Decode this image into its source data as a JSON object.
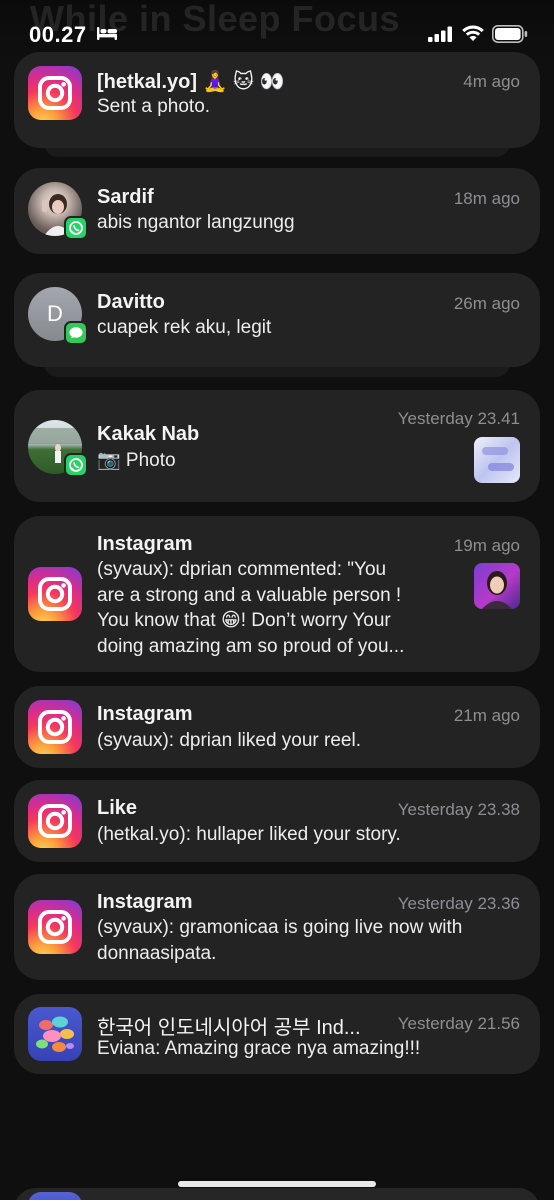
{
  "status_bar": {
    "ghost_title": "While in Sleep Focus",
    "time": "00.27",
    "icons": [
      "bed-icon",
      "signal-icon",
      "wifi-icon",
      "battery-icon"
    ]
  },
  "notifications": [
    {
      "app": "instagram",
      "title": "[hetkal.yo] 🧘‍♀️ 🐱 👀",
      "time": "4m ago",
      "body": [
        "Sent a photo."
      ]
    },
    {
      "app": "whatsapp",
      "title": "Sardif",
      "time": "18m ago",
      "body": [
        "abis ngantor langzungg"
      ]
    },
    {
      "app": "messages",
      "title": "Davitto",
      "time": "26m ago",
      "avatar_letter": "D",
      "body": [
        "cuapek rek aku, legit"
      ]
    },
    {
      "app": "whatsapp",
      "title": "Kakak Nab",
      "time": "Yesterday 23.41",
      "body": [
        "📷 Photo"
      ]
    },
    {
      "app": "instagram",
      "title": "Instagram",
      "time": "19m ago",
      "body": [
        "(syvaux): dprian commented: \"You",
        "are a strong and a valuable person !",
        "You know that 😁! Don’t worry Your",
        "doing amazing am so proud of you..."
      ]
    },
    {
      "app": "instagram",
      "title": "Instagram",
      "time": "21m ago",
      "body": [
        "(syvaux): dprian liked your reel."
      ]
    },
    {
      "app": "instagram",
      "title": "Like",
      "time": "Yesterday 23.38",
      "body": [
        "(hetkal.yo): hullaper liked your story."
      ]
    },
    {
      "app": "instagram",
      "title": "Instagram",
      "time": "Yesterday 23.36",
      "body": [
        "(syvaux): gramonicaa is going live now with",
        "donnaasipata."
      ]
    },
    {
      "app": "korean-indonesian",
      "title": "한국어 인도네시아어 공부 Ind...",
      "time": "Yesterday 21.56",
      "body": [
        "Eviana: Amazing grace nya amazing!!!"
      ]
    }
  ],
  "colors": {
    "background": "#0f0f0f",
    "card": "#232323",
    "secondary_text": "#8e8e93",
    "whatsapp": "#25d366",
    "messages": "#34c759"
  }
}
